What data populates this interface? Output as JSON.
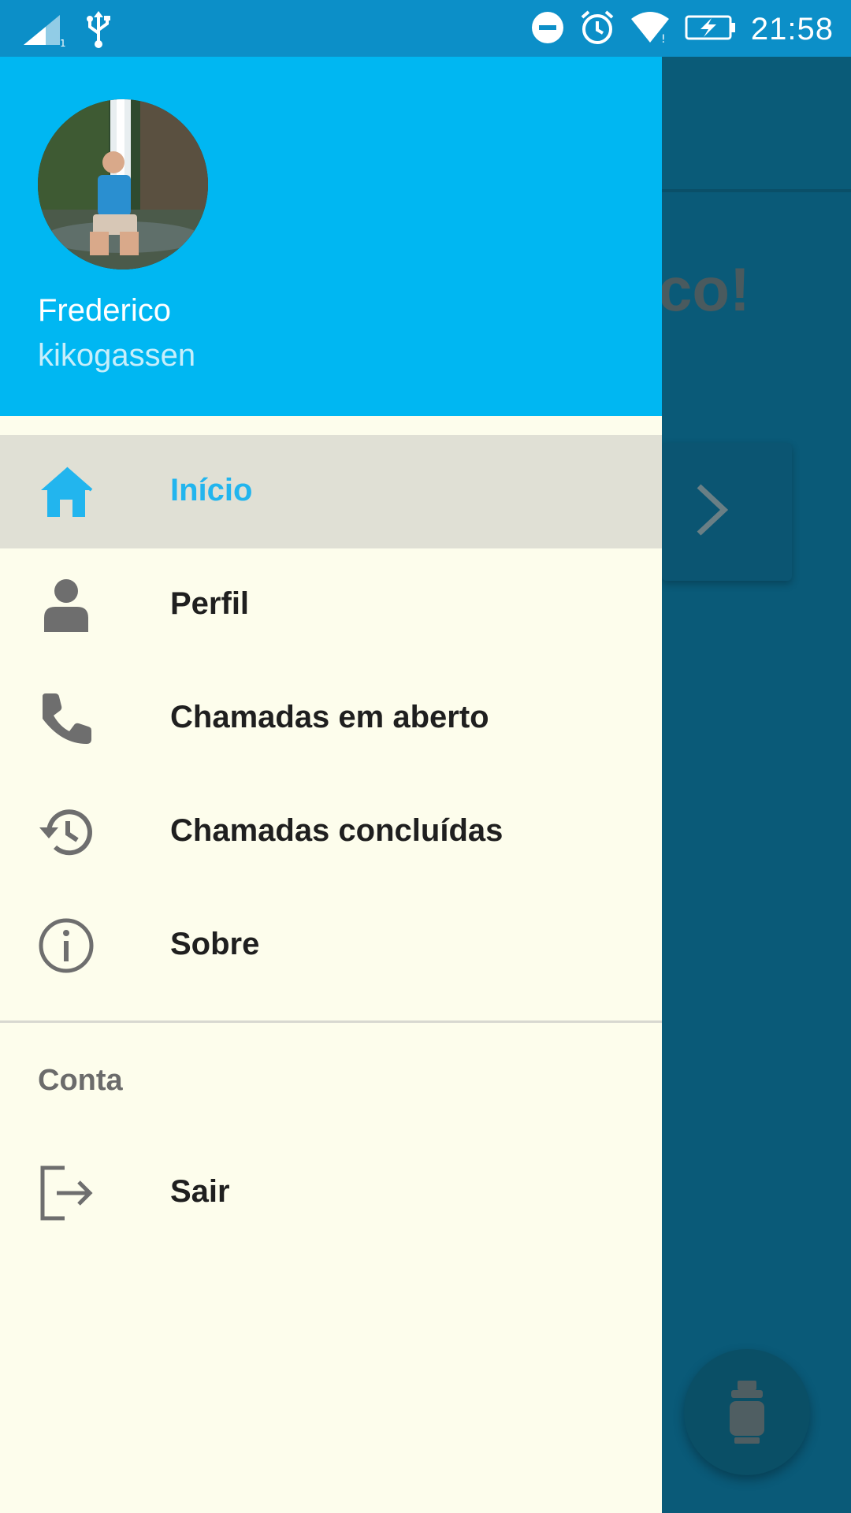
{
  "status_bar": {
    "time": "21:58",
    "icons": [
      "signal-icon",
      "usb-icon",
      "dnd-icon",
      "alarm-icon",
      "wifi-icon",
      "battery-charging-icon"
    ]
  },
  "background": {
    "heading_fragment": "co!",
    "card_icon": "chevron-right-icon",
    "fab_icon": "gas-cylinder-icon"
  },
  "drawer": {
    "user": {
      "name": "Frederico",
      "username": "kikogassen"
    },
    "items": [
      {
        "label": "Início",
        "icon": "home-icon",
        "active": true
      },
      {
        "label": "Perfil",
        "icon": "person-icon",
        "active": false
      },
      {
        "label": "Chamadas em aberto",
        "icon": "phone-icon",
        "active": false
      },
      {
        "label": "Chamadas concluídas",
        "icon": "history-icon",
        "active": false
      },
      {
        "label": "Sobre",
        "icon": "info-icon",
        "active": false
      }
    ],
    "section_title": "Conta",
    "account_items": [
      {
        "label": "Sair",
        "icon": "logout-icon"
      }
    ]
  },
  "colors": {
    "header": "#00b7f2",
    "accent": "#22b5ee",
    "drawer_bg": "#fdfdec",
    "active_item_bg": "#e0e0d5",
    "status_bar": "#0c8fc8"
  }
}
